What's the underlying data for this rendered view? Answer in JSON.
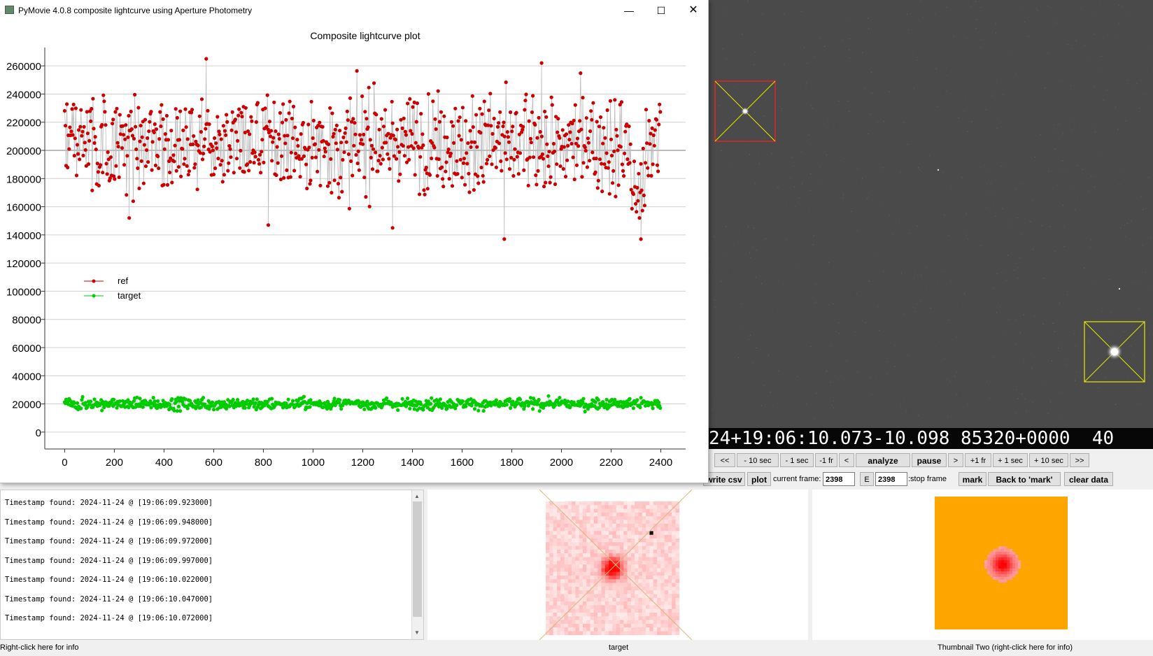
{
  "window": {
    "title": "PyMovie 4.0.8 composite lightcurve using Aperture Photometry",
    "minimize_icon": "minimize-icon",
    "maximize_icon": "maximize-icon",
    "close_icon": "close-icon"
  },
  "chart_data": {
    "type": "scatter",
    "title": "Composite lightcurve plot",
    "xlabel": "",
    "ylabel": "",
    "xlim": [
      -80,
      2500
    ],
    "ylim": [
      -12000,
      272000
    ],
    "x_ticks": [
      0,
      200,
      400,
      600,
      800,
      1000,
      1200,
      1400,
      1600,
      1800,
      2000,
      2200,
      2400
    ],
    "y_ticks": [
      0,
      20000,
      40000,
      60000,
      80000,
      100000,
      120000,
      140000,
      160000,
      180000,
      200000,
      220000,
      240000,
      260000
    ],
    "x_tick_labels": [
      "0",
      "200",
      "400",
      "600",
      "800",
      "1000",
      "1200",
      "1400",
      "1600",
      "1800",
      "2000",
      "2200",
      "2400"
    ],
    "y_tick_labels": [
      "0",
      "20000",
      "40000",
      "60000",
      "80000",
      "100000",
      "120000",
      "140000",
      "160000",
      "180000",
      "200000",
      "220000",
      "240000",
      "260000"
    ],
    "grid": "horizontal",
    "legend_placement": "left-middle",
    "series": [
      {
        "name": "ref",
        "color": "#cc0000",
        "x_range": [
          0,
          2398
        ],
        "approx_mean": 205000,
        "approx_spread": 22000,
        "notable_points": [
          [
            570,
            265000
          ],
          [
            1920,
            262000
          ],
          [
            1770,
            137000
          ],
          [
            2320,
            137000
          ],
          [
            820,
            147000
          ],
          [
            260,
            152000
          ],
          [
            1320,
            145000
          ]
        ]
      },
      {
        "name": "target",
        "color": "#00cc00",
        "x_range": [
          0,
          2398
        ],
        "approx_mean": 20000,
        "approx_spread": 2500
      }
    ],
    "reference_line": 200000
  },
  "starfield": {
    "timestamp_text": "24+19:06:10.073-10.098 85320+0000  40"
  },
  "controls": {
    "row1": [
      "<<",
      "- 10 sec",
      "- 1 sec",
      "-1 fr",
      "<",
      "analyze",
      "pause",
      ">",
      "+1 fr",
      "+ 1 sec",
      "+ 10 sec",
      ">>"
    ],
    "write_csv": "write csv",
    "plot": "plot",
    "current_frame_label": "current frame:",
    "current_frame_value": "2398",
    "e_button": "E",
    "stop_frame_value": "2398",
    "stop_frame_label": ":stop frame",
    "mark": "mark",
    "back_to_mark": "Back to 'mark'",
    "clear_data": "clear data"
  },
  "log": {
    "lines": [
      "Timestamp found: 2024-11-24 @ [19:06:09.923000]",
      "Timestamp found: 2024-11-24 @ [19:06:09.948000]",
      "Timestamp found: 2024-11-24 @ [19:06:09.972000]",
      "Timestamp found: 2024-11-24 @ [19:06:09.997000]",
      "Timestamp found: 2024-11-24 @ [19:06:10.022000]",
      "Timestamp found: 2024-11-24 @ [19:06:10.047000]",
      "Timestamp found: 2024-11-24 @ [19:06:10.072000]"
    ]
  },
  "status": {
    "left": "Right-click here for info",
    "center": "target",
    "right": "Thumbnail Two (right-click here for info)"
  },
  "colors": {
    "thumb2_background": "#ffa500",
    "aperture_red": "#ff0000",
    "aperture_yellow": "#e8e800"
  }
}
